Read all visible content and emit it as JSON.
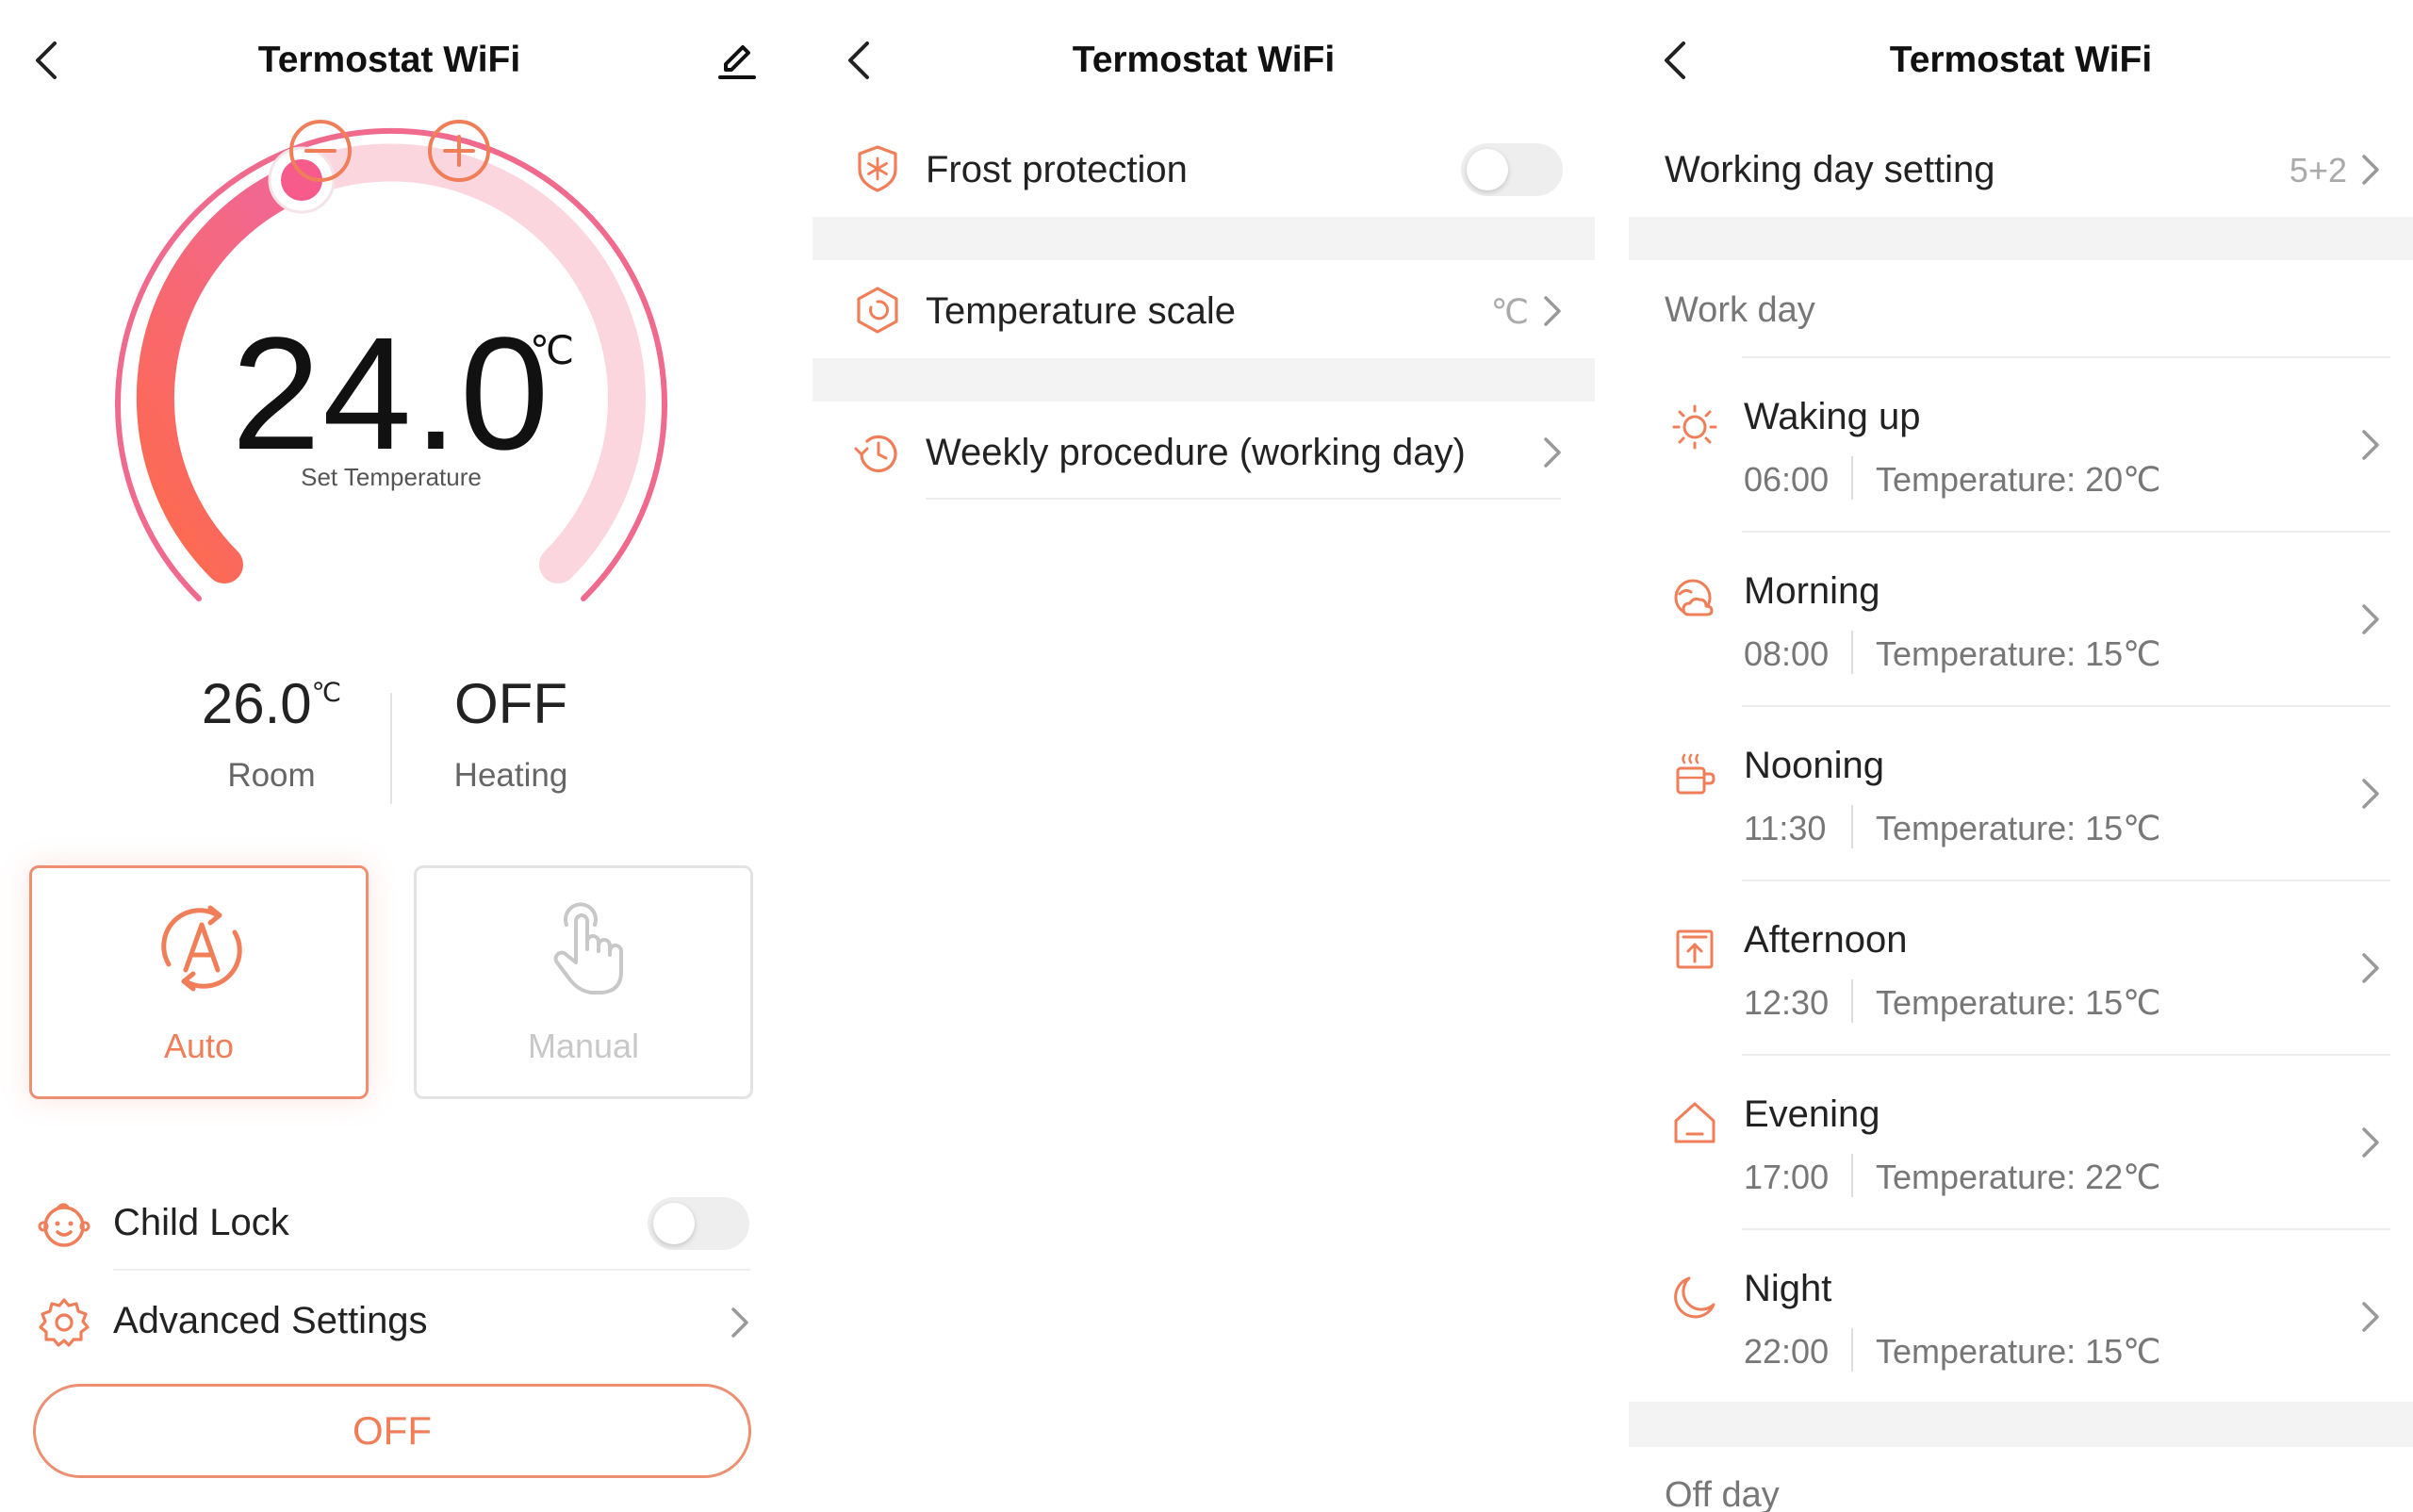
{
  "app_title": "Termostat WiFi",
  "colors": {
    "accent": "#f07e58",
    "accent_pink": "#f2678f",
    "dial_track": "#fbd6df",
    "muted_text": "#777777",
    "band": "#f3f3f3"
  },
  "screen1": {
    "header": {
      "title": "Termostat WiFi",
      "back_icon": "chevron-left-icon",
      "edit_icon": "pencil-icon"
    },
    "dial": {
      "set_temperature": "24.0",
      "unit": "℃",
      "label": "Set Temperature",
      "minus_icon": "minus-circle-icon",
      "plus_icon": "plus-circle-icon"
    },
    "room": {
      "value": "26.0",
      "unit": "℃",
      "label": "Room"
    },
    "heating": {
      "value": "OFF",
      "label": "Heating"
    },
    "modes": [
      {
        "label": "Auto",
        "icon": "auto-cycle-icon",
        "selected": true
      },
      {
        "label": "Manual",
        "icon": "hand-pointer-icon",
        "selected": false
      }
    ],
    "child_lock": {
      "label": "Child Lock",
      "icon": "baby-face-icon",
      "enabled": false
    },
    "advanced": {
      "label": "Advanced Settings",
      "icon": "gear-icon"
    },
    "power_button": "OFF"
  },
  "screen2": {
    "header": {
      "title": "Termostat WiFi",
      "back_icon": "chevron-left-icon"
    },
    "frost": {
      "label": "Frost protection",
      "icon": "snowflake-shield-icon",
      "enabled": false
    },
    "scale": {
      "label": "Temperature scale",
      "value": "℃",
      "icon": "hexagon-gauge-icon"
    },
    "weekly": {
      "label": "Weekly procedure (working day)",
      "icon": "clock-refresh-icon"
    }
  },
  "screen3": {
    "header": {
      "title": "Termostat WiFi",
      "back_icon": "chevron-left-icon"
    },
    "working_day": {
      "label": "Working day setting",
      "value": "5+2"
    },
    "work_day_title": "Work day",
    "periods": [
      {
        "name": "Waking up",
        "time": "06:00",
        "temp": "Temperature: 20℃",
        "icon": "sun-icon"
      },
      {
        "name": "Morning",
        "time": "08:00",
        "temp": "Temperature: 15℃",
        "icon": "sun-cloud-icon"
      },
      {
        "name": "Nooning",
        "time": "11:30",
        "temp": "Temperature: 15℃",
        "icon": "hot-cup-icon"
      },
      {
        "name": "Afternoon",
        "time": "12:30",
        "temp": "Temperature: 15℃",
        "icon": "upload-box-icon"
      },
      {
        "name": "Evening",
        "time": "17:00",
        "temp": "Temperature: 22℃",
        "icon": "home-icon"
      },
      {
        "name": "Night",
        "time": "22:00",
        "temp": "Temperature: 15℃",
        "icon": "moon-icon"
      }
    ],
    "off_day_title": "Off day"
  }
}
